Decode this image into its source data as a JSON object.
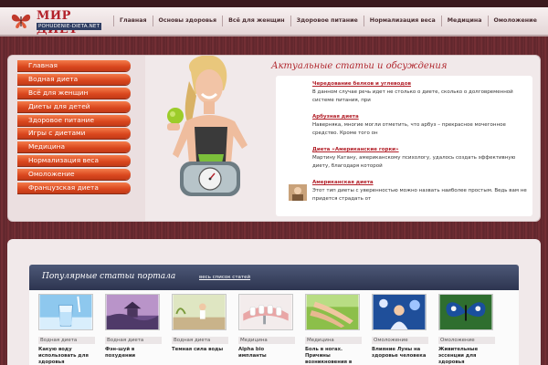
{
  "header": {
    "logo_name": "МИР ДИЕТ",
    "logo_domain": "POHUDENIE-DIETA.NET",
    "nav": [
      "Главная",
      "Основы здоровья",
      "Всё для женщин",
      "Здоровое питание",
      "Нормализация веса",
      "Медицина",
      "Омоложение"
    ]
  },
  "sidebar": {
    "items": [
      "Главная",
      "Водная диета",
      "Всё для женщин",
      "Диеты для детей",
      "Здоровое питание",
      "Игры с диетами",
      "Медицина",
      "Нормализация веса",
      "Омоложение",
      "Французская диета"
    ]
  },
  "featured": {
    "headline": "Актуальные статьи и обсуждения",
    "articles": [
      {
        "title": "Чередование белков и углеводов",
        "text": "В данном случае речь идет не столько о диете, сколько о долговременной системе питания, при"
      },
      {
        "title": "Арбузная диета",
        "text": "Наверняка, многие могли отметить, что арбуз – прекрасное мочегонное средство. Кроме того он"
      },
      {
        "title": "Диета «Американские горки»",
        "text": "Мартину Катану, американскому психологу, удалось создать эффективную диету, благодаря которой"
      },
      {
        "title": "Американская диета",
        "text": "Этот тип диеты с уверенностью можно назвать наиболее простым. Ведь вам не придется страдать от"
      }
    ]
  },
  "popular": {
    "title": "Популярные статьи портала",
    "all_link": "весь список статей",
    "cards": [
      {
        "category": "Водная диета",
        "title": "Какую воду использовать для здоровья",
        "icon": "water-glass"
      },
      {
        "category": "Водная диета",
        "title": "Фэн-шуй в похудении",
        "icon": "pagoda-landscape"
      },
      {
        "category": "Водная диета",
        "title": "Темная сила воды",
        "icon": "beach-woman"
      },
      {
        "category": "Медицина",
        "title": "Alpha bio импланты",
        "icon": "dental-implants"
      },
      {
        "category": "Медицина",
        "title": "Боль в ногах. Причины возникновения в",
        "icon": "legs-grass"
      },
      {
        "category": "Омоложение",
        "title": "Влияние Луны на здоровье человека",
        "icon": "moon-woman"
      },
      {
        "category": "Омоложение",
        "title": "Живительные эссенции для здоровья",
        "icon": "butterfly"
      }
    ]
  },
  "colors": {
    "accent_red": "#b3212a",
    "menu_orange": "#d9461e",
    "popular_bar": "#2d3550",
    "background": "#6b2b30"
  }
}
